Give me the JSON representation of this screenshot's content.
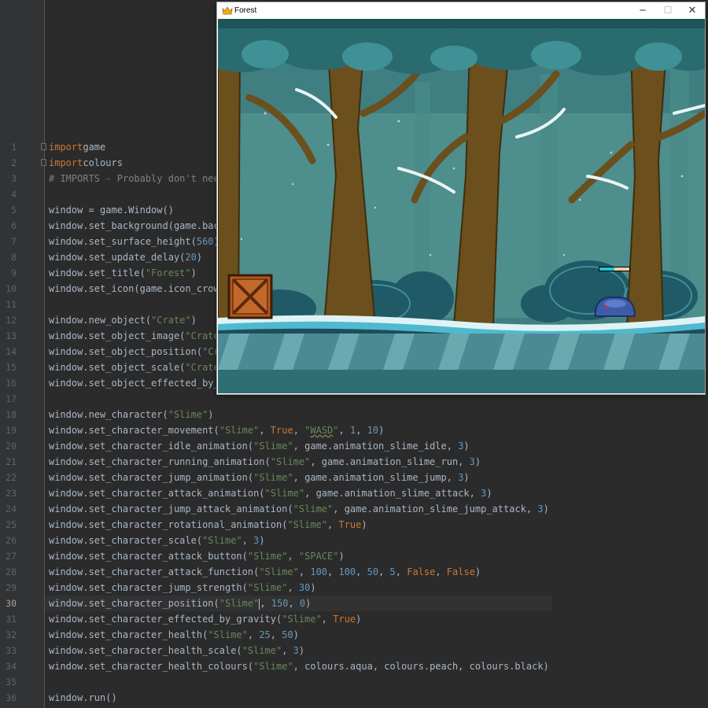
{
  "editor": {
    "current_line": 30,
    "lines": [
      {
        "n": "1",
        "fold": true,
        "tokens": [
          [
            "kw",
            "import"
          ],
          [
            "",
            "game"
          ]
        ]
      },
      {
        "n": "2",
        "fold": true,
        "tokens": [
          [
            "kw",
            "import"
          ],
          [
            "",
            "colours"
          ]
        ]
      },
      {
        "n": "3",
        "tokens": [
          [
            "cm",
            "# IMPORTS - Probably don't need"
          ]
        ]
      },
      {
        "n": "4",
        "tokens": []
      },
      {
        "n": "5",
        "tokens": [
          [
            "",
            "window = game.Window()"
          ]
        ]
      },
      {
        "n": "6",
        "tokens": [
          [
            "",
            "window.set_background(game.back"
          ]
        ]
      },
      {
        "n": "7",
        "tokens": [
          [
            "",
            "window.set_surface_height("
          ],
          [
            "num",
            "560"
          ],
          [
            "",
            ")"
          ]
        ]
      },
      {
        "n": "8",
        "tokens": [
          [
            "",
            "window.set_update_delay("
          ],
          [
            "num",
            "20"
          ],
          [
            "",
            ")"
          ]
        ]
      },
      {
        "n": "9",
        "tokens": [
          [
            "",
            "window.set_title("
          ],
          [
            "str",
            "\"Forest\""
          ],
          [
            "",
            ")"
          ]
        ]
      },
      {
        "n": "10",
        "tokens": [
          [
            "",
            "window.set_icon(game.icon_crown"
          ]
        ]
      },
      {
        "n": "11",
        "tokens": []
      },
      {
        "n": "12",
        "tokens": [
          [
            "",
            "window.new_object("
          ],
          [
            "str",
            "\"Crate\""
          ],
          [
            "",
            ")"
          ]
        ]
      },
      {
        "n": "13",
        "tokens": [
          [
            "",
            "window.set_object_image("
          ],
          [
            "str",
            "\"Crate\""
          ]
        ]
      },
      {
        "n": "14",
        "tokens": [
          [
            "",
            "window.set_object_position("
          ],
          [
            "str",
            "\"Cra"
          ]
        ]
      },
      {
        "n": "15",
        "tokens": [
          [
            "",
            "window.set_object_scale("
          ],
          [
            "str",
            "\"Crate\""
          ]
        ]
      },
      {
        "n": "16",
        "tokens": [
          [
            "",
            "window.set_object_effected_by_g"
          ]
        ]
      },
      {
        "n": "17",
        "tokens": []
      },
      {
        "n": "18",
        "tokens": [
          [
            "",
            "window.new_character("
          ],
          [
            "str",
            "\"Slime\""
          ],
          [
            "",
            ")"
          ]
        ]
      },
      {
        "n": "19",
        "tokens": [
          [
            "",
            "window.set_character_movement("
          ],
          [
            "str",
            "\"Slime\""
          ],
          [
            "",
            ", "
          ],
          [
            "kw",
            "True"
          ],
          [
            "",
            ", "
          ],
          [
            "str",
            "\""
          ],
          [
            "squig",
            "WASD"
          ],
          [
            "str",
            "\""
          ],
          [
            "",
            ", "
          ],
          [
            "num",
            "1"
          ],
          [
            "",
            ", "
          ],
          [
            "num",
            "10"
          ],
          [
            "",
            ")"
          ]
        ]
      },
      {
        "n": "20",
        "tokens": [
          [
            "",
            "window.set_character_idle_animation("
          ],
          [
            "str",
            "\"Slime\""
          ],
          [
            "",
            ", game.animation_slime_idle, "
          ],
          [
            "num",
            "3"
          ],
          [
            "",
            ")"
          ]
        ]
      },
      {
        "n": "21",
        "tokens": [
          [
            "",
            "window.set_character_running_animation("
          ],
          [
            "str",
            "\"Slime\""
          ],
          [
            "",
            ", game.animation_slime_run, "
          ],
          [
            "num",
            "3"
          ],
          [
            "",
            ")"
          ]
        ]
      },
      {
        "n": "22",
        "tokens": [
          [
            "",
            "window.set_character_jump_animation("
          ],
          [
            "str",
            "\"Slime\""
          ],
          [
            "",
            ", game.animation_slime_jump, "
          ],
          [
            "num",
            "3"
          ],
          [
            "",
            ")"
          ]
        ]
      },
      {
        "n": "23",
        "tokens": [
          [
            "",
            "window.set_character_attack_animation("
          ],
          [
            "str",
            "\"Slime\""
          ],
          [
            "",
            ", game.animation_slime_attack, "
          ],
          [
            "num",
            "3"
          ],
          [
            "",
            ")"
          ]
        ]
      },
      {
        "n": "24",
        "tokens": [
          [
            "",
            "window.set_character_jump_attack_animation("
          ],
          [
            "str",
            "\"Slime\""
          ],
          [
            "",
            ", game.animation_slime_jump_attack, "
          ],
          [
            "num",
            "3"
          ],
          [
            "",
            ")"
          ]
        ]
      },
      {
        "n": "25",
        "tokens": [
          [
            "",
            "window.set_character_rotational_animation("
          ],
          [
            "str",
            "\"Slime\""
          ],
          [
            "",
            ", "
          ],
          [
            "kw",
            "True"
          ],
          [
            "",
            ")"
          ]
        ]
      },
      {
        "n": "26",
        "tokens": [
          [
            "",
            "window.set_character_scale("
          ],
          [
            "str",
            "\"Slime\""
          ],
          [
            "",
            ", "
          ],
          [
            "num",
            "3"
          ],
          [
            "",
            ")"
          ]
        ]
      },
      {
        "n": "27",
        "tokens": [
          [
            "",
            "window.set_character_attack_button("
          ],
          [
            "str",
            "\"Slime\""
          ],
          [
            "",
            ", "
          ],
          [
            "str",
            "\"SPACE\""
          ],
          [
            "",
            ")"
          ]
        ]
      },
      {
        "n": "28",
        "tokens": [
          [
            "",
            "window.set_character_attack_function("
          ],
          [
            "str",
            "\"Slime\""
          ],
          [
            "",
            ", "
          ],
          [
            "num",
            "100"
          ],
          [
            "",
            ", "
          ],
          [
            "num",
            "100"
          ],
          [
            "",
            ", "
          ],
          [
            "num",
            "50"
          ],
          [
            "",
            ", "
          ],
          [
            "num",
            "5"
          ],
          [
            "",
            ", "
          ],
          [
            "kw",
            "False"
          ],
          [
            "",
            ", "
          ],
          [
            "kw",
            "False"
          ],
          [
            "",
            ")"
          ]
        ]
      },
      {
        "n": "29",
        "tokens": [
          [
            "",
            "window.set_character_jump_strength("
          ],
          [
            "str",
            "\"Slime\""
          ],
          [
            "",
            ", "
          ],
          [
            "num",
            "30"
          ],
          [
            "",
            ")"
          ]
        ]
      },
      {
        "n": "30",
        "tokens": [
          [
            "",
            "window.set_character_position("
          ],
          [
            "str",
            "\"Slime\""
          ],
          [
            "caret",
            ""
          ],
          [
            "",
            ", "
          ],
          [
            "num",
            "150"
          ],
          [
            "",
            ", "
          ],
          [
            "num",
            "0"
          ],
          [
            "",
            ")"
          ]
        ]
      },
      {
        "n": "31",
        "tokens": [
          [
            "",
            "window.set_character_effected_by_gravity("
          ],
          [
            "str",
            "\"Slime\""
          ],
          [
            "",
            ", "
          ],
          [
            "kw",
            "True"
          ],
          [
            "",
            ")"
          ]
        ]
      },
      {
        "n": "32",
        "tokens": [
          [
            "",
            "window.set_character_health("
          ],
          [
            "str",
            "\"Slime\""
          ],
          [
            "",
            ", "
          ],
          [
            "num",
            "25"
          ],
          [
            "",
            ", "
          ],
          [
            "num",
            "50"
          ],
          [
            "",
            ")"
          ]
        ]
      },
      {
        "n": "33",
        "tokens": [
          [
            "",
            "window.set_character_health_scale("
          ],
          [
            "str",
            "\"Slime\""
          ],
          [
            "",
            ", "
          ],
          [
            "num",
            "3"
          ],
          [
            "",
            ")"
          ]
        ]
      },
      {
        "n": "34",
        "tokens": [
          [
            "",
            "window.set_character_health_colours("
          ],
          [
            "str",
            "\"Slime\""
          ],
          [
            "",
            ", colours.aqua, colours.peach, colours.black)"
          ]
        ]
      },
      {
        "n": "35",
        "tokens": []
      },
      {
        "n": "36",
        "tokens": [
          [
            "",
            "window.run()"
          ]
        ]
      }
    ]
  },
  "game_window": {
    "title": "Forest",
    "icon": "crown-icon",
    "controls": {
      "minimize": "─",
      "maximize": "☐",
      "close": "✕"
    },
    "health": {
      "current": 25,
      "max": 50,
      "fill": 0.5,
      "colors": {
        "fill": "#19c9d2",
        "empty": "#f3cfa6",
        "border": "#000000"
      }
    }
  },
  "colors": {
    "editor_bg": "#2b2b2b",
    "keyword": "#cc7832",
    "string": "#6a8759",
    "number": "#6897bb",
    "comment": "#808080"
  }
}
